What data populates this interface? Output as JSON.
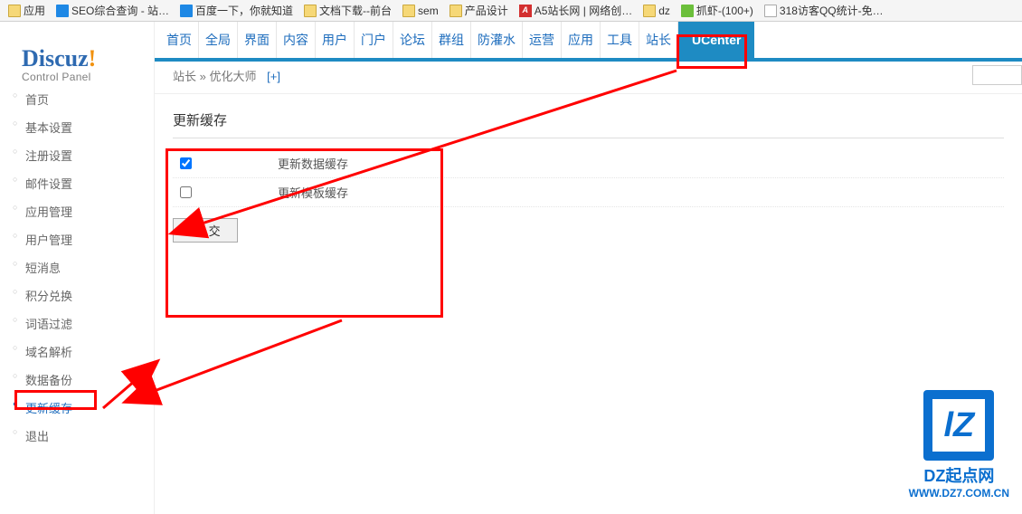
{
  "bookmarks": [
    {
      "label": "应用",
      "icon": "bi-folder"
    },
    {
      "label": "SEO综合查询 - 站…",
      "icon": "bi-blue"
    },
    {
      "label": "百度一下，你就知道",
      "icon": "bi-blue"
    },
    {
      "label": "文档下载--前台",
      "icon": "bi-folder"
    },
    {
      "label": "sem",
      "icon": "bi-folder"
    },
    {
      "label": "产品设计",
      "icon": "bi-folder"
    },
    {
      "label": "A5站长网 | 网络创…",
      "icon": "bi-red",
      "glyph": "A"
    },
    {
      "label": "dz",
      "icon": "bi-folder"
    },
    {
      "label": "抓虾-(100+)",
      "icon": "bi-green"
    },
    {
      "label": "318访客QQ统计-免…",
      "icon": "bi-white"
    }
  ],
  "logo": {
    "title": "Discuz",
    "exclaim": "!",
    "subtitle": "Control Panel"
  },
  "topnav": [
    "首页",
    "全局",
    "界面",
    "内容",
    "用户",
    "门户",
    "论坛",
    "群组",
    "防灌水",
    "运营",
    "应用",
    "工具",
    "站长"
  ],
  "topnav_ucenter": "UCenter",
  "breadcrumb": {
    "a": "站长",
    "sep": "»",
    "b": "优化大师",
    "plus": "[+]"
  },
  "sidebar": [
    "首页",
    "基本设置",
    "注册设置",
    "邮件设置",
    "应用管理",
    "用户管理",
    "短消息",
    "积分兑换",
    "词语过滤",
    "域名解析",
    "数据备份",
    "更新缓存",
    "退出"
  ],
  "sidebar_active_index": 11,
  "section_title": "更新缓存",
  "options": [
    {
      "label": "更新数据缓存",
      "checked": true
    },
    {
      "label": "更新模板缓存",
      "checked": false
    }
  ],
  "submit": "提 交",
  "watermark": {
    "logo": "lZ",
    "line1": "DZ起点网",
    "line2": "WWW.DZ7.COM.CN"
  }
}
